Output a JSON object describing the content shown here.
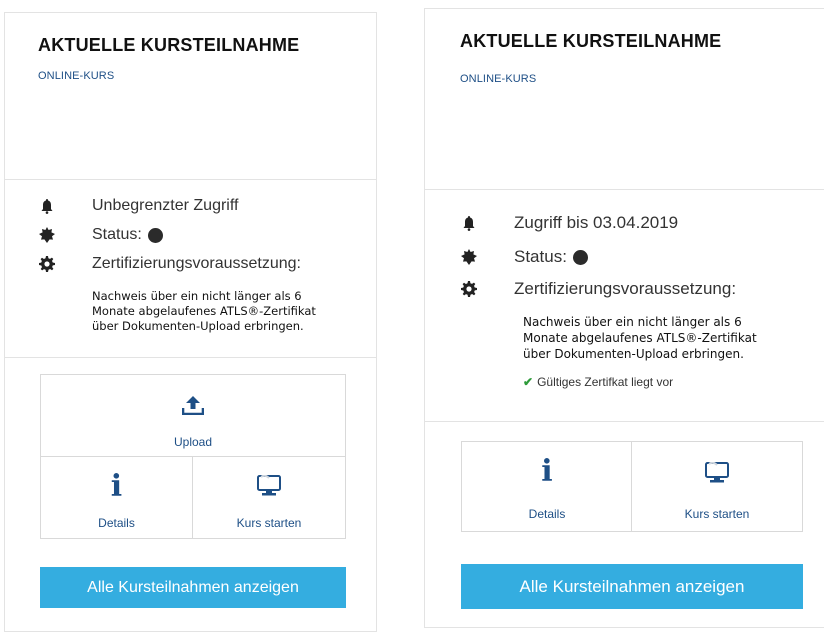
{
  "left_card": {
    "title": "AKTUELLE KURSTEILNAHME",
    "subtitle": "ONLINE-KURS",
    "access_text": "Unbegrenzter Zugriff",
    "status_label": "Status:",
    "cert_label": "Zertifizierungsvoraussetzung:",
    "cert_note_line1": "Nachweis über ein nicht länger als 6",
    "cert_note_line2": "Monate abgelaufenes ATLS®-Zertifikat",
    "cert_note_line3": "über Dokumenten-Upload erbringen.",
    "tiles": {
      "upload": "Upload",
      "details": "Details",
      "start": "Kurs starten"
    },
    "all_button": "Alle Kursteilnahmen anzeigen"
  },
  "right_card": {
    "title": "AKTUELLE KURSTEILNAHME",
    "subtitle": "ONLINE-KURS",
    "access_text": "Zugriff bis 03.04.2019",
    "status_label": "Status:",
    "cert_label": "Zertifizierungsvoraussetzung:",
    "cert_note_line1": "Nachweis über ein nicht länger als 6",
    "cert_note_line2": "Monate abgelaufenes ATLS®-Zertifikat",
    "cert_note_line3": "über Dokumenten-Upload erbringen.",
    "valid_text": "Gültiges Zertifkat liegt vor",
    "tiles": {
      "details": "Details",
      "start": "Kurs starten"
    },
    "all_button": "Alle Kursteilnahmen anzeigen"
  },
  "icons": {
    "access": "bell-icon",
    "status": "badge-icon",
    "cert": "gear-icon",
    "upload": "upload-icon",
    "details": "info-icon",
    "start": "monitor-icon",
    "valid": "checkmark-icon"
  },
  "colors": {
    "accent": "#34ade0",
    "link": "#1e4f86",
    "check": "#2e9b3a",
    "status_dot": "#2b2b2b"
  }
}
